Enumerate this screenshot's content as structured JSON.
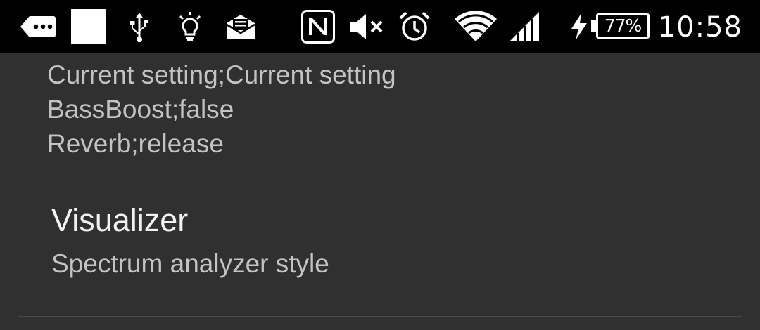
{
  "status_bar": {
    "icons": [
      "more-notifications-icon",
      "blank-notification-icon",
      "usb-icon",
      "lightbulb-icon",
      "email-icon",
      "nfc-icon",
      "mute-icon",
      "alarm-icon",
      "wifi-icon",
      "cell-signal-icon",
      "charging-icon",
      "battery-icon"
    ],
    "battery_percent": "77%",
    "time": "10:58"
  },
  "current_setting": {
    "lines": [
      "Current setting;Current setting",
      "BassBoost;false",
      "Reverb;release"
    ]
  },
  "visualizer": {
    "title": "Visualizer",
    "summary": "Spectrum analyzer style"
  },
  "colors": {
    "status_bar_bg": "#000000",
    "background": "#303030",
    "title_text": "#f2f2f2",
    "summary_text": "#c3c3c3",
    "divider": "#4a4a4a"
  }
}
